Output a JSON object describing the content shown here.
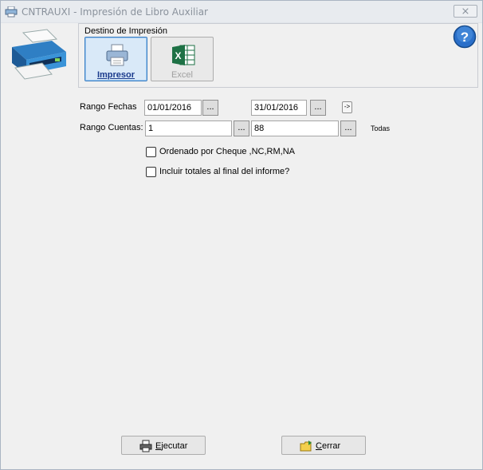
{
  "window": {
    "title": "CNTRAUXI - Impresión de Libro Auxiliar",
    "close_glyph": "⨯"
  },
  "destino": {
    "group_label": "Destino de Impresión",
    "options": [
      {
        "label": "Impresor",
        "icon": "printer-icon",
        "selected": true,
        "enabled": true
      },
      {
        "label": "Excel",
        "icon": "excel-icon",
        "selected": false,
        "enabled": false
      }
    ]
  },
  "form": {
    "rango_fechas_label": "Rango Fechas",
    "fecha_desde": "01/01/2016",
    "fecha_hasta": "31/01/2016",
    "rango_cuentas_label": "Rango Cuentas:",
    "cuenta_desde": "1",
    "cuenta_hasta": "88",
    "ellipsis_label": "...",
    "arrow_label": "->",
    "todas_label": "Todas",
    "chk_ordenado_label": "Ordenado por Cheque ,NC,RM,NA",
    "chk_ordenado_checked": false,
    "chk_totales_label": "Incluir totales al final del informe?",
    "chk_totales_checked": false
  },
  "buttons": {
    "ejecutar": {
      "mnemonic": "E",
      "rest": "jecutar"
    },
    "cerrar": {
      "mnemonic": "C",
      "rest": "errar"
    }
  },
  "colors": {
    "accent": "#1a3a8c",
    "excel_green": "#1e7145"
  }
}
